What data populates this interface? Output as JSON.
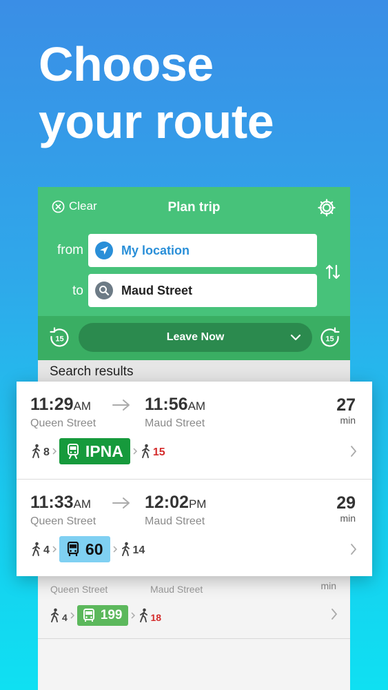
{
  "headline": {
    "line1": "Choose",
    "line2": "your route"
  },
  "nav": {
    "clear_label": "Clear",
    "title": "Plan trip"
  },
  "trip": {
    "from_label": "from",
    "from_value": "My location",
    "to_label": "to",
    "to_value": "Maud Street"
  },
  "time": {
    "leave_label": "Leave Now",
    "back_minutes": "15",
    "forward_minutes": "15"
  },
  "results_header": "Search results",
  "results": [
    {
      "depart_time": "11:29",
      "depart_ampm": "AM",
      "arrive_time": "11:56",
      "arrive_ampm": "AM",
      "from_stop": "Queen Street",
      "to_stop": "Maud Street",
      "duration": "27",
      "duration_unit": "min",
      "walk_before": "8",
      "route": "IPNA",
      "route_type": "train",
      "walk_after": "15"
    },
    {
      "depart_time": "11:33",
      "depart_ampm": "AM",
      "arrive_time": "12:02",
      "arrive_ampm": "PM",
      "from_stop": "Queen Street",
      "to_stop": "Maud Street",
      "duration": "29",
      "duration_unit": "min",
      "walk_before": "4",
      "route": "60",
      "route_type": "bus",
      "walk_after": "14"
    },
    {
      "from_stop": "Queen Street",
      "to_stop": "Maud Street",
      "duration_unit": "min",
      "walk_before": "4",
      "route": "199",
      "route_type": "bus",
      "walk_after": "18"
    }
  ],
  "colors": {
    "header_green": "#47c27a",
    "time_bar_green": "#3aae63",
    "train_badge": "#169a3c",
    "bus_badge_blue": "#7fd0f2",
    "bus_badge_green": "#5cb85c",
    "link_blue": "#2a8fd8",
    "late_red": "#d42b2b"
  },
  "icons": {
    "clear": "close-circle-icon",
    "settings": "gear-icon",
    "from": "location-arrow-icon",
    "to": "search-icon",
    "swap": "swap-arrows-icon",
    "time_back": "rewind-15-icon",
    "time_forward": "forward-15-icon",
    "walk": "walking-person-icon",
    "train": "train-icon",
    "bus": "bus-icon"
  }
}
